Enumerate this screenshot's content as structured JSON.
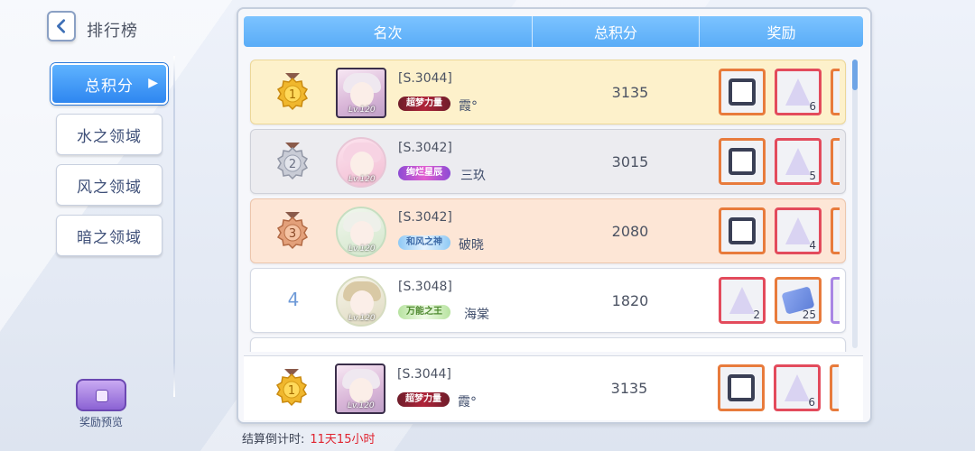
{
  "header": {
    "title": "排行榜"
  },
  "sidebar": {
    "items": [
      {
        "label": "总积分",
        "active": true
      },
      {
        "label": "水之领域",
        "active": false
      },
      {
        "label": "风之领域",
        "active": false
      },
      {
        "label": "暗之领域",
        "active": false
      }
    ],
    "reward_preview_label": "奖励预览"
  },
  "table": {
    "headers": {
      "rank": "名次",
      "score": "总积分",
      "reward": "奖励"
    }
  },
  "rows": [
    {
      "rank": "1",
      "server": "[S.3044]",
      "title_badge": "超梦力量",
      "name": "霞°",
      "level": "Lv.120",
      "score": "3135",
      "rewards": [
        {
          "type": "frame",
          "qty": ""
        },
        {
          "type": "crystal",
          "qty": "6"
        }
      ]
    },
    {
      "rank": "2",
      "server": "[S.3042]",
      "title_badge": "绚烂星辰",
      "name": "三玖",
      "level": "Lv.120",
      "score": "3015",
      "rewards": [
        {
          "type": "frame",
          "qty": ""
        },
        {
          "type": "crystal",
          "qty": "5"
        }
      ]
    },
    {
      "rank": "3",
      "server": "[S.3042]",
      "title_badge": "和风之神",
      "name": "破晓",
      "level": "Lv.120",
      "score": "2080",
      "rewards": [
        {
          "type": "frame",
          "qty": ""
        },
        {
          "type": "crystal",
          "qty": "4"
        }
      ]
    },
    {
      "rank": "4",
      "server": "[S.3048]",
      "title_badge": "万能之王",
      "name": "海棠",
      "level": "Lv.120",
      "score": "1820",
      "rewards": [
        {
          "type": "crystal",
          "qty": "2"
        },
        {
          "type": "ticket",
          "qty": "25"
        }
      ]
    }
  ],
  "my_row": {
    "rank": "1",
    "server": "[S.3044]",
    "title_badge": "超梦力量",
    "name": "霞°",
    "level": "Lv.120",
    "score": "3135",
    "rewards": [
      {
        "type": "frame",
        "qty": ""
      },
      {
        "type": "crystal",
        "qty": "6"
      }
    ]
  },
  "footer": {
    "countdown_label": "结算倒计时:",
    "countdown_value": "11天15小时"
  },
  "colors": {
    "accent": "#4aa3f5",
    "gold_row": "#fdf1cb",
    "silver_row": "#ececf0",
    "bronze_row": "#fde6d6",
    "countdown": "#e0232f"
  }
}
